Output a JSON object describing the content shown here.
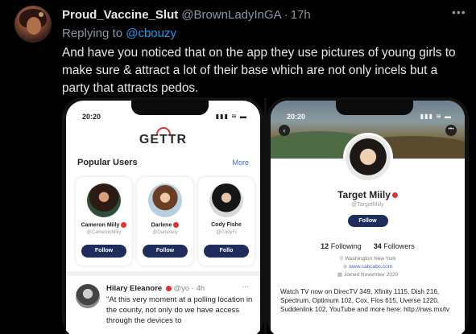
{
  "tweet": {
    "display_name": "Proud_Vaccine_Slut",
    "handle": "@BrownLadyInGA",
    "separator": "·",
    "time": "17h",
    "more_icon": "more-dots-icon",
    "replying_prefix": "Replying to",
    "replying_handle": "@cbouzy",
    "text": "And have you noticed that on the app they use pictures of young girls to make sure & attract a lot of their base which are not only incels but a party that attracts pedos."
  },
  "left_phone": {
    "status_time": "20:20",
    "status_icons": "▮▮▮ ≋ ▬",
    "logo": "GETTR",
    "section_title": "Popular Users",
    "more_label": "More",
    "users": [
      {
        "name": "Cameron Miily",
        "handle": "@CameronMiily",
        "follow_label": "Follow"
      },
      {
        "name": "Darlene",
        "handle": "@Darlenely",
        "follow_label": "Follow"
      },
      {
        "name": "Cody Fishe",
        "handle": "@CodyFi",
        "follow_label": "Follo"
      }
    ],
    "post": {
      "author": "Hilary Eleanore",
      "handle": "@yo",
      "separator": "·",
      "time": "4h",
      "more": "···",
      "text": "\"At this very moment at a polling location in the county, not only do we have access through the devices to"
    }
  },
  "right_phone": {
    "status_time": "20:20",
    "status_icons": "▮▮▮ ≋ ▬",
    "back_icon": "‹",
    "menu_icon": "•••",
    "name": "Target Miily",
    "handle": "@TargetMiily",
    "follow_label": "Follow",
    "following_count": "12",
    "following_label": "Following",
    "followers_count": "34",
    "followers_label": "Followers",
    "location": "Washington New York",
    "website": "www.cabcabc.com",
    "joined": "Joined November 2020",
    "bio": "Watch TV now on DirecTV 349, Xfinity 1115, Dish 216, Spectrum, Optimum 102, Cox, Fios 615, Uverse 1220, Suddenlink 102, YouTube and more here: http://nws.mx/tv"
  },
  "colors": {
    "background": "#000000",
    "name_text": "#e7e9ea",
    "muted_text": "#8b98a5",
    "link_blue": "#1d9bf0",
    "gettr_navy": "#1f2d5c",
    "gettr_red": "#dd3333"
  }
}
